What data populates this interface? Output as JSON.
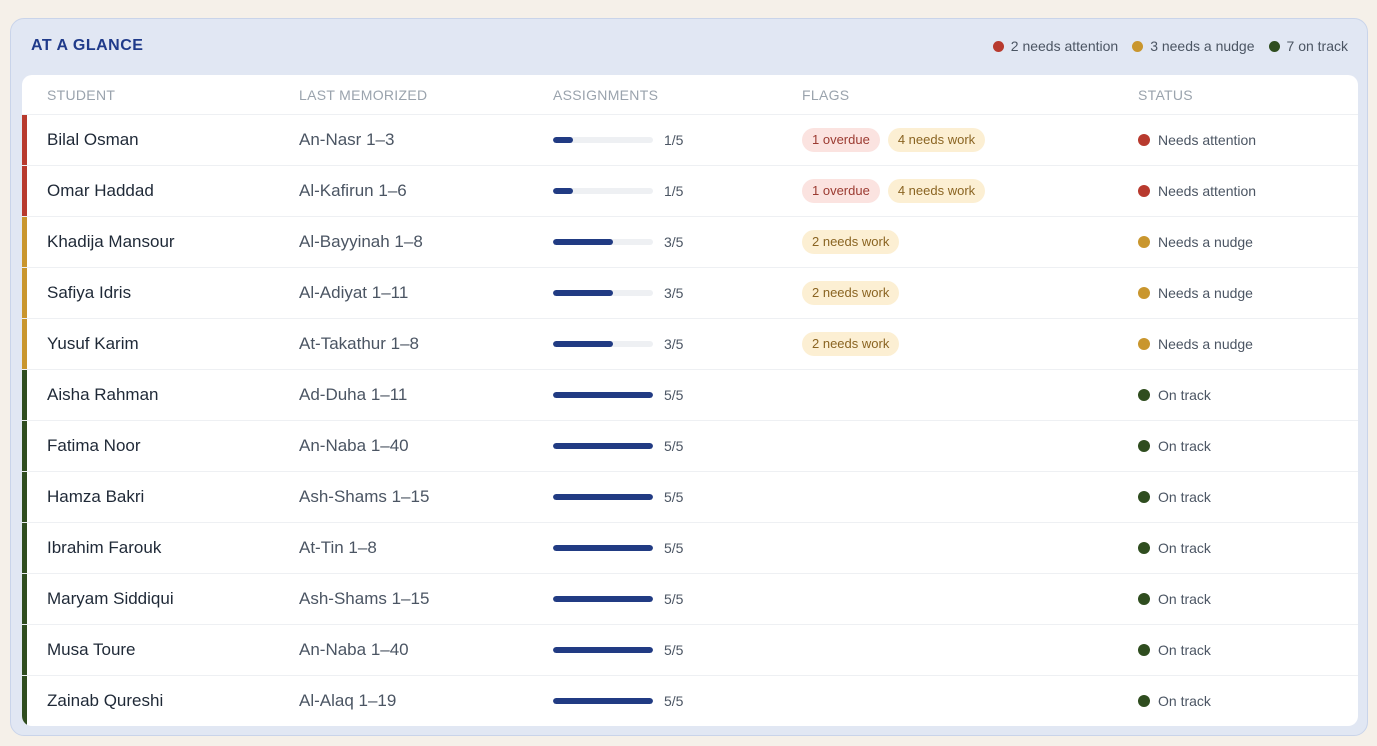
{
  "header": {
    "title": "AT A GLANCE",
    "summary": [
      {
        "label": "2 needs attention",
        "color": "#b83a2e"
      },
      {
        "label": "3 needs a nudge",
        "color": "#c9962e"
      },
      {
        "label": "7 on track",
        "color": "#2f4d1f"
      }
    ]
  },
  "columns": {
    "student": "STUDENT",
    "last_memorized": "LAST MEMORIZED",
    "assignments": "ASSIGNMENTS",
    "flags": "FLAGS",
    "status": "STATUS"
  },
  "status_colors": {
    "attention": "#b83a2e",
    "nudge": "#c9962e",
    "ontrack": "#2f4d1f"
  },
  "rows": [
    {
      "name": "Bilal Osman",
      "memorized": "An-Nasr 1–3",
      "done": 1,
      "total": 5,
      "assignments": "1/5",
      "flags": [
        "1 overdue",
        "4 needs work"
      ],
      "status": "Needs attention",
      "level": "attention"
    },
    {
      "name": "Omar Haddad",
      "memorized": "Al-Kafirun 1–6",
      "done": 1,
      "total": 5,
      "assignments": "1/5",
      "flags": [
        "1 overdue",
        "4 needs work"
      ],
      "status": "Needs attention",
      "level": "attention"
    },
    {
      "name": "Khadija Mansour",
      "memorized": "Al-Bayyinah 1–8",
      "done": 3,
      "total": 5,
      "assignments": "3/5",
      "flags": [
        "2 needs work"
      ],
      "status": "Needs a nudge",
      "level": "nudge"
    },
    {
      "name": "Safiya Idris",
      "memorized": "Al-Adiyat 1–11",
      "done": 3,
      "total": 5,
      "assignments": "3/5",
      "flags": [
        "2 needs work"
      ],
      "status": "Needs a nudge",
      "level": "nudge"
    },
    {
      "name": "Yusuf Karim",
      "memorized": "At-Takathur 1–8",
      "done": 3,
      "total": 5,
      "assignments": "3/5",
      "flags": [
        "2 needs work"
      ],
      "status": "Needs a nudge",
      "level": "nudge"
    },
    {
      "name": "Aisha Rahman",
      "memorized": "Ad-Duha 1–11",
      "done": 5,
      "total": 5,
      "assignments": "5/5",
      "flags": [],
      "status": "On track",
      "level": "ontrack"
    },
    {
      "name": "Fatima Noor",
      "memorized": "An-Naba 1–40",
      "done": 5,
      "total": 5,
      "assignments": "5/5",
      "flags": [],
      "status": "On track",
      "level": "ontrack"
    },
    {
      "name": "Hamza Bakri",
      "memorized": "Ash-Shams 1–15",
      "done": 5,
      "total": 5,
      "assignments": "5/5",
      "flags": [],
      "status": "On track",
      "level": "ontrack"
    },
    {
      "name": "Ibrahim Farouk",
      "memorized": "At-Tin 1–8",
      "done": 5,
      "total": 5,
      "assignments": "5/5",
      "flags": [],
      "status": "On track",
      "level": "ontrack"
    },
    {
      "name": "Maryam Siddiqui",
      "memorized": "Ash-Shams 1–15",
      "done": 5,
      "total": 5,
      "assignments": "5/5",
      "flags": [],
      "status": "On track",
      "level": "ontrack"
    },
    {
      "name": "Musa Toure",
      "memorized": "An-Naba 1–40",
      "done": 5,
      "total": 5,
      "assignments": "5/5",
      "flags": [],
      "status": "On track",
      "level": "ontrack"
    },
    {
      "name": "Zainab Qureshi",
      "memorized": "Al-Alaq 1–19",
      "done": 5,
      "total": 5,
      "assignments": "5/5",
      "flags": [],
      "status": "On track",
      "level": "ontrack"
    }
  ]
}
